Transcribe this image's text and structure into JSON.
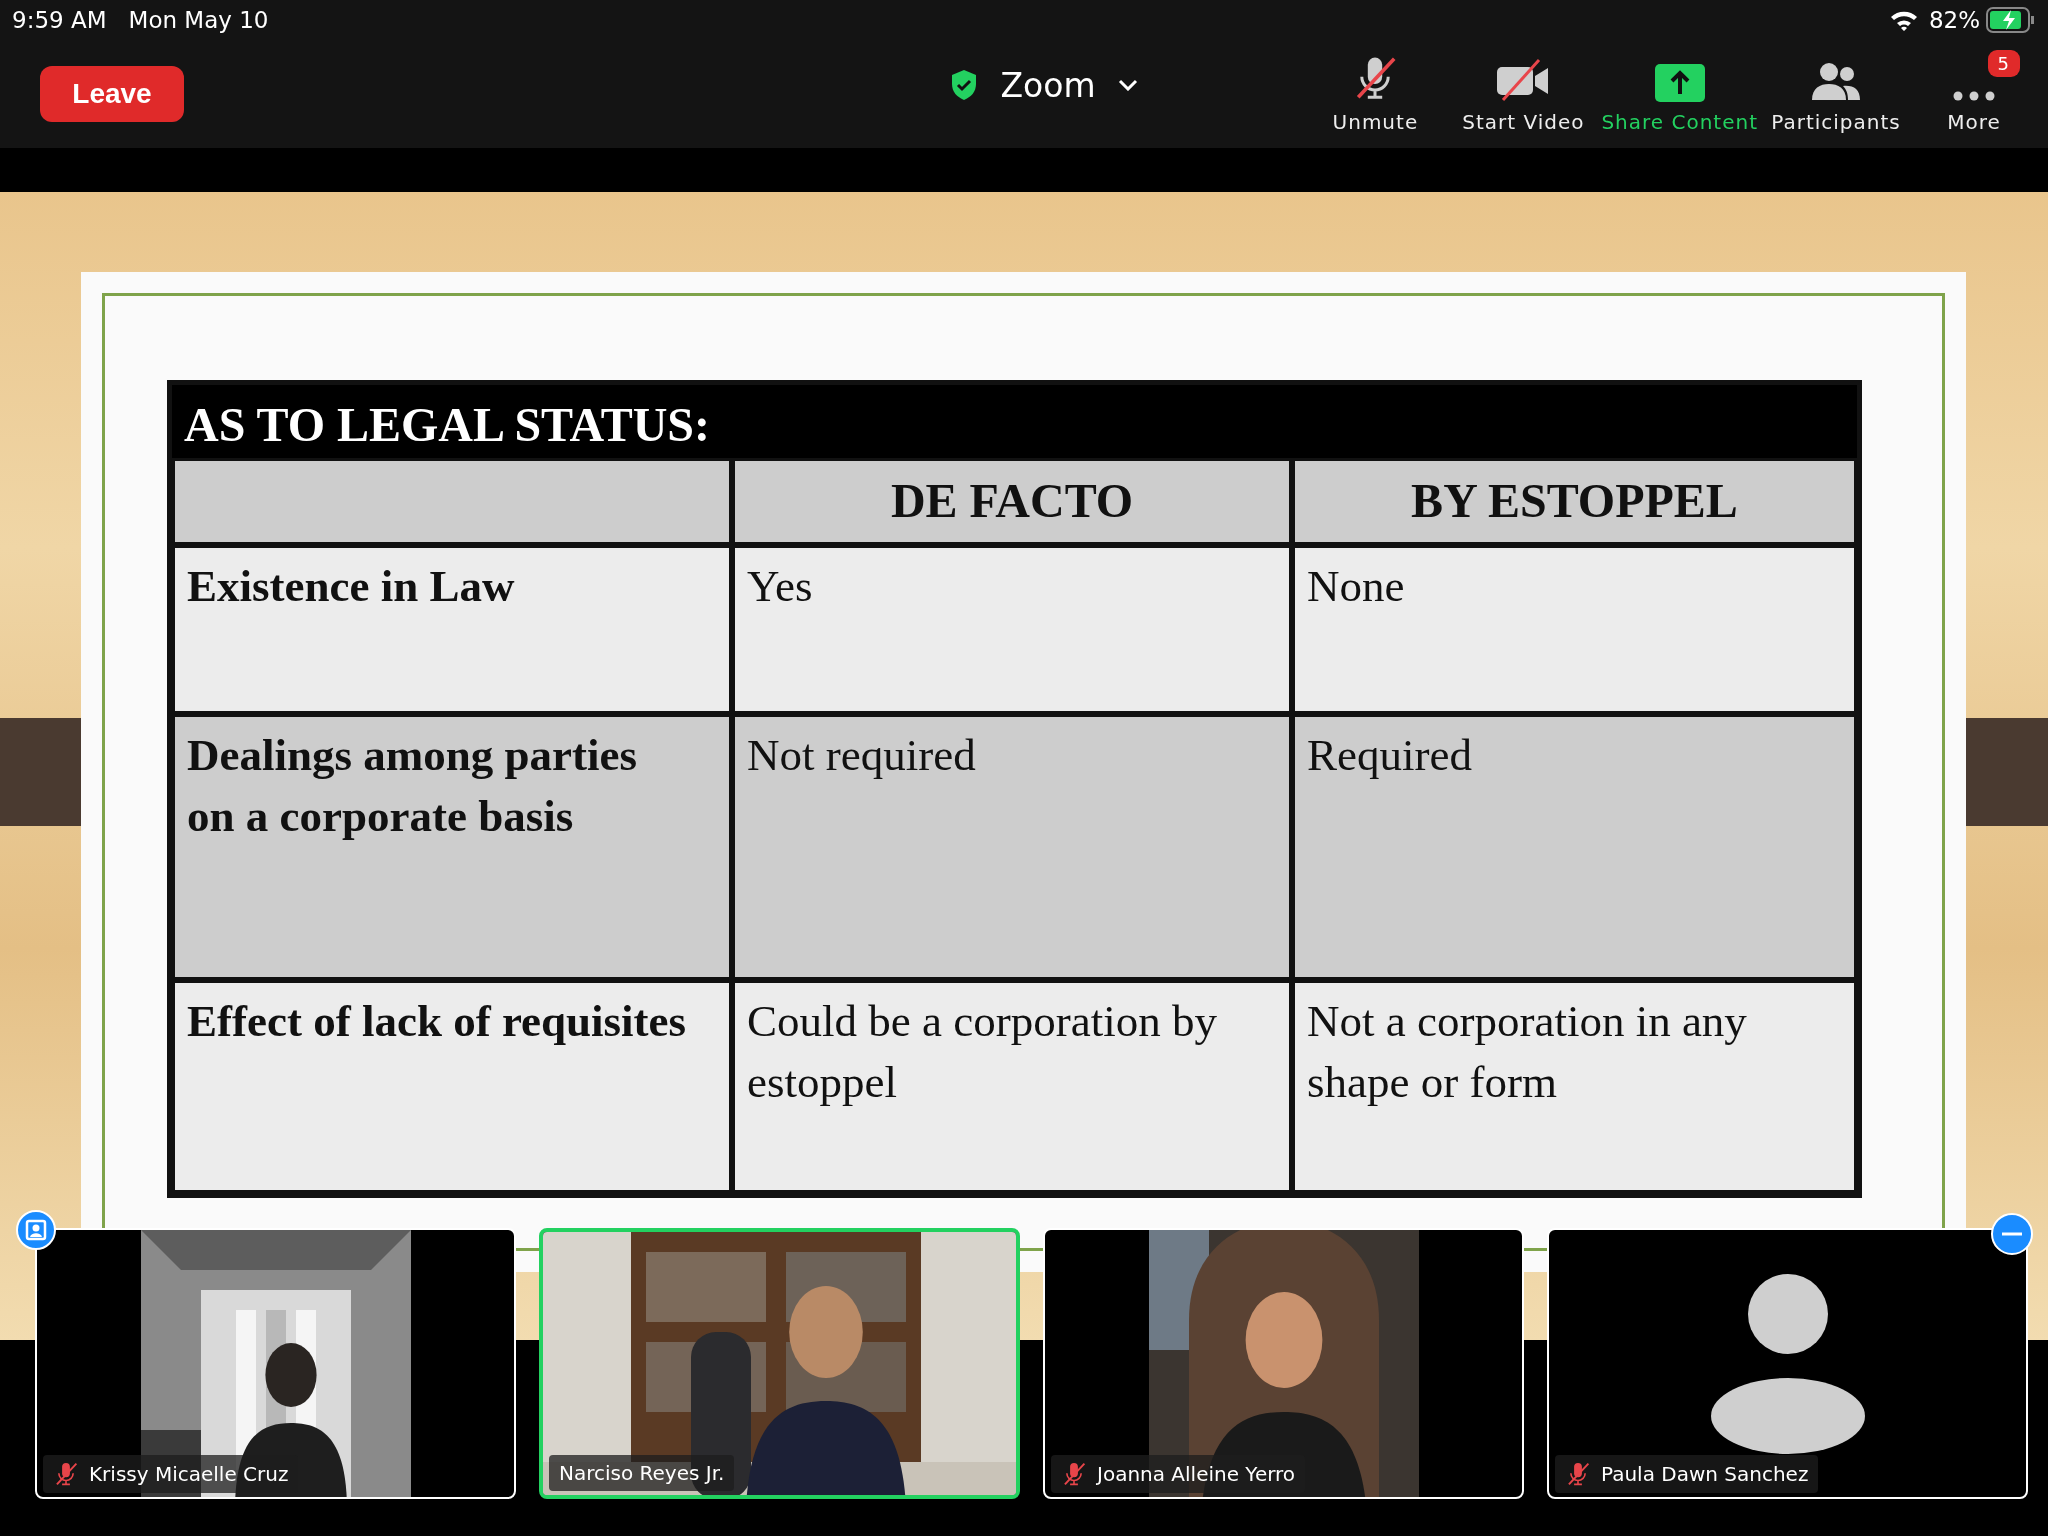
{
  "status_bar": {
    "time": "9:59 AM",
    "date": "Mon May 10",
    "battery": "82%"
  },
  "leave_button": {
    "label": "Leave"
  },
  "meeting_title": {
    "label": "Zoom"
  },
  "toolbar": [
    {
      "kind": "mic",
      "label": "Unmute",
      "highlighted": false
    },
    {
      "kind": "video",
      "label": "Start Video",
      "highlighted": false
    },
    {
      "kind": "share",
      "label": "Share Content",
      "highlighted": true
    },
    {
      "kind": "participants",
      "label": "Participants",
      "highlighted": false
    },
    {
      "kind": "more",
      "label": "More",
      "highlighted": false,
      "badge": "5"
    }
  ],
  "slide": {
    "title": "AS TO LEGAL STATUS:",
    "column_headers": [
      "DE FACTO",
      "BY ESTOPPEL"
    ],
    "rows": [
      {
        "label": "Existence in Law",
        "shaded": false,
        "cells": [
          "Yes",
          "None"
        ]
      },
      {
        "label": "Dealings among parties on a corporate basis",
        "shaded": true,
        "cells": [
          "Not required",
          "Required"
        ]
      },
      {
        "label": "Effect of lack of requisites",
        "shaded": false,
        "cells": [
          "Could be a corporation by estoppel",
          "Not a corporation in any shape or form"
        ]
      }
    ]
  },
  "participants": [
    {
      "name": "Krissy Micaelle Cruz",
      "kind": "video",
      "muted": true,
      "active_speaker": false
    },
    {
      "name": "Narciso Reyes Jr.",
      "kind": "video",
      "muted": false,
      "active_speaker": true
    },
    {
      "name": "Joanna Alleine Yerro",
      "kind": "video",
      "muted": true,
      "active_speaker": false
    },
    {
      "name": "Paula Dawn Sanchez",
      "kind": "avatar",
      "muted": true,
      "active_speaker": false
    }
  ]
}
